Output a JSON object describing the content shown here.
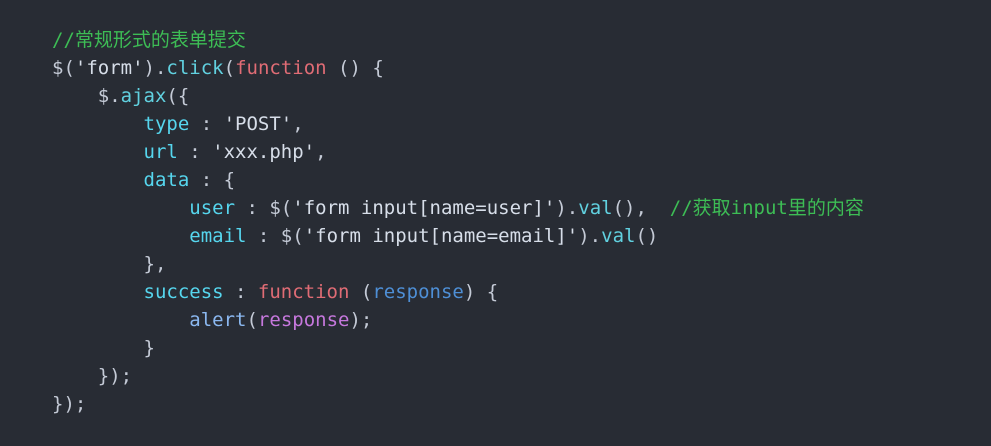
{
  "editor": {
    "lines": [
      [
        {
          "t": "//常规形式的表单提交",
          "k": "comment"
        }
      ],
      [
        {
          "t": "$(",
          "k": "plain"
        },
        {
          "t": "'form'",
          "k": "string"
        },
        {
          "t": ").",
          "k": "plain"
        },
        {
          "t": "click",
          "k": "method"
        },
        {
          "t": "(",
          "k": "plain"
        },
        {
          "t": "function",
          "k": "keyword"
        },
        {
          "t": " () {",
          "k": "plain"
        }
      ],
      [
        {
          "t": "    $.",
          "k": "plain"
        },
        {
          "t": "ajax",
          "k": "method"
        },
        {
          "t": "({",
          "k": "plain"
        }
      ],
      [
        {
          "t": "        ",
          "k": "plain"
        },
        {
          "t": "type",
          "k": "prop"
        },
        {
          "t": " : ",
          "k": "plain"
        },
        {
          "t": "'POST'",
          "k": "string"
        },
        {
          "t": ",",
          "k": "plain"
        }
      ],
      [
        {
          "t": "        ",
          "k": "plain"
        },
        {
          "t": "url",
          "k": "prop"
        },
        {
          "t": " : ",
          "k": "plain"
        },
        {
          "t": "'xxx.php'",
          "k": "string"
        },
        {
          "t": ",",
          "k": "plain"
        }
      ],
      [
        {
          "t": "        ",
          "k": "plain"
        },
        {
          "t": "data",
          "k": "prop"
        },
        {
          "t": " : {",
          "k": "plain"
        }
      ],
      [
        {
          "t": "            ",
          "k": "plain"
        },
        {
          "t": "user",
          "k": "prop"
        },
        {
          "t": " : $(",
          "k": "plain"
        },
        {
          "t": "'form input[name=user]'",
          "k": "string"
        },
        {
          "t": ").",
          "k": "plain"
        },
        {
          "t": "val",
          "k": "method"
        },
        {
          "t": "(),  ",
          "k": "plain"
        },
        {
          "t": "//获取input里的内容",
          "k": "comment"
        }
      ],
      [
        {
          "t": "            ",
          "k": "plain"
        },
        {
          "t": "email",
          "k": "prop"
        },
        {
          "t": " : $(",
          "k": "plain"
        },
        {
          "t": "'form input[name=email]'",
          "k": "string"
        },
        {
          "t": ").",
          "k": "plain"
        },
        {
          "t": "val",
          "k": "method"
        },
        {
          "t": "()",
          "k": "plain"
        }
      ],
      [
        {
          "t": "        },",
          "k": "plain"
        }
      ],
      [
        {
          "t": "        ",
          "k": "plain"
        },
        {
          "t": "success",
          "k": "prop"
        },
        {
          "t": " : ",
          "k": "plain"
        },
        {
          "t": "function",
          "k": "keyword"
        },
        {
          "t": " (",
          "k": "plain"
        },
        {
          "t": "response",
          "k": "param"
        },
        {
          "t": ") {",
          "k": "plain"
        }
      ],
      [
        {
          "t": "            ",
          "k": "plain"
        },
        {
          "t": "alert",
          "k": "fn"
        },
        {
          "t": "(",
          "k": "plain"
        },
        {
          "t": "response",
          "k": "var"
        },
        {
          "t": ");",
          "k": "plain"
        }
      ],
      [
        {
          "t": "        }",
          "k": "plain"
        }
      ],
      [
        {
          "t": "    });",
          "k": "plain"
        }
      ],
      [
        {
          "t": "});",
          "k": "plain"
        }
      ]
    ],
    "colors": {
      "background": "#282c34",
      "comment": "#3dbd55",
      "string": "#d7dee9",
      "method": "#61d1e0",
      "keyword": "#e06c75",
      "property": "#56d6ee",
      "parameter": "#4e8fd6",
      "variable": "#c678dd",
      "function": "#8bb8f0",
      "plain": "#c4cad6"
    }
  }
}
